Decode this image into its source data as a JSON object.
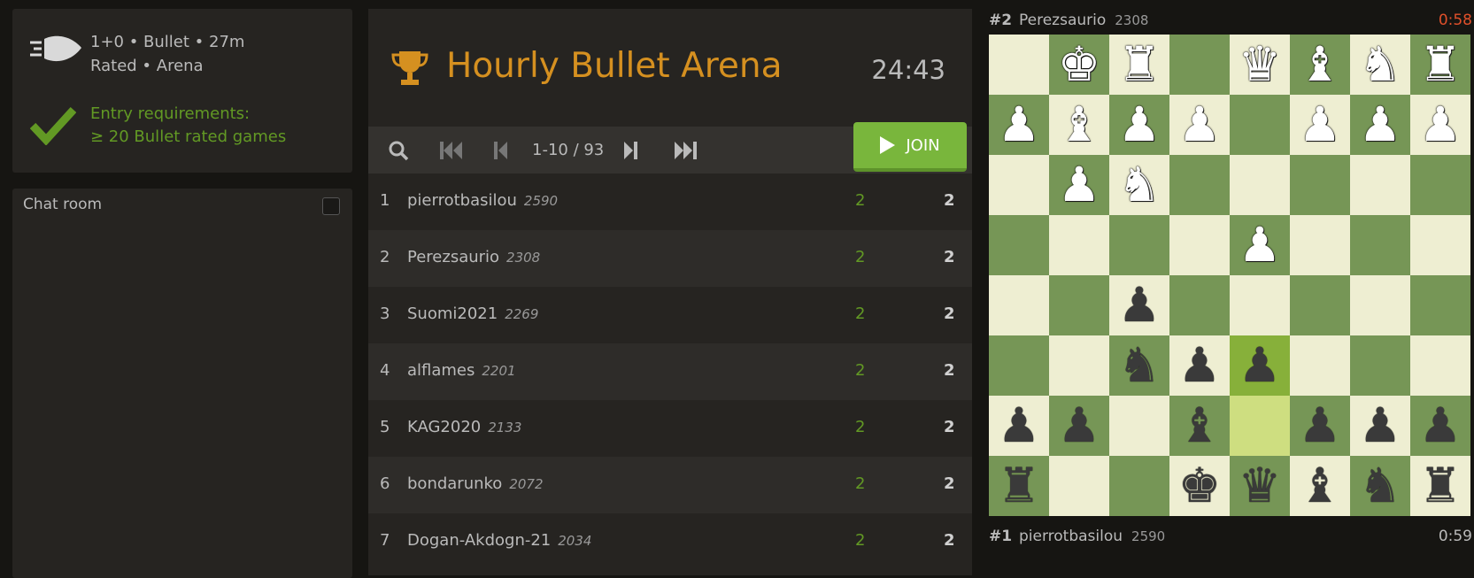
{
  "tournament": {
    "line1": "1+0 • Bullet • 27m",
    "line2": "Rated • Arena",
    "req_line1": "Entry requirements:",
    "req_line2": "≥ 20 Bullet rated games",
    "title": "Hourly Bullet Arena",
    "clock": "24:43"
  },
  "chat": {
    "title": "Chat room"
  },
  "pager": {
    "range": "1-10 / 93",
    "join_label": "JOIN"
  },
  "standings": [
    {
      "rank": "1",
      "name": "pierrotbasilou",
      "rating": "2590",
      "sheet": "2",
      "score": "2"
    },
    {
      "rank": "2",
      "name": "Perezsaurio",
      "rating": "2308",
      "sheet": "2",
      "score": "2"
    },
    {
      "rank": "3",
      "name": "Suomi2021",
      "rating": "2269",
      "sheet": "2",
      "score": "2"
    },
    {
      "rank": "4",
      "name": "alflames",
      "rating": "2201",
      "sheet": "2",
      "score": "2"
    },
    {
      "rank": "5",
      "name": "KAG2020",
      "rating": "2133",
      "sheet": "2",
      "score": "2"
    },
    {
      "rank": "6",
      "name": "bondarunko",
      "rating": "2072",
      "sheet": "2",
      "score": "2"
    },
    {
      "rank": "7",
      "name": "Dogan-Akdogn-21",
      "rating": "2034",
      "sheet": "2",
      "score": "2"
    }
  ],
  "featured": {
    "top": {
      "rank": "#2",
      "name": "Perezsaurio",
      "rating": "2308",
      "time": "0:58"
    },
    "bottom": {
      "rank": "#1",
      "name": "pierrotbasilou",
      "rating": "2590",
      "time": "0:59"
    },
    "board": [
      [
        "",
        "wK",
        "wR",
        "",
        "wQ",
        "wB",
        "wN",
        "wR"
      ],
      [
        "wP",
        "wB",
        "wP",
        "wP",
        "",
        "wP",
        "wP",
        "wP"
      ],
      [
        "",
        "wP",
        "wN",
        "",
        "",
        "",
        "",
        ""
      ],
      [
        "",
        "",
        "",
        "",
        "wP",
        "",
        "",
        ""
      ],
      [
        "",
        "",
        "bP",
        "",
        "",
        "",
        "",
        ""
      ],
      [
        "",
        "",
        "bN",
        "bP",
        "bP",
        "",
        "",
        ""
      ],
      [
        "bP",
        "bP",
        "",
        "bB",
        "",
        "bP",
        "bP",
        "bP"
      ],
      [
        "bR",
        "",
        "",
        "bK",
        "bQ",
        "bB",
        "bN",
        "bR"
      ]
    ],
    "highlight": [
      [
        5,
        4
      ],
      [
        6,
        4
      ]
    ]
  },
  "colors": {
    "accent": "#d59020",
    "green": "#629924",
    "join": "#79b63c",
    "low_time": "#e0502a"
  },
  "icons": [
    "bullet-icon",
    "check-icon",
    "trophy-icon",
    "search-icon",
    "first-page-icon",
    "prev-page-icon",
    "next-page-icon",
    "last-page-icon",
    "play-icon"
  ]
}
